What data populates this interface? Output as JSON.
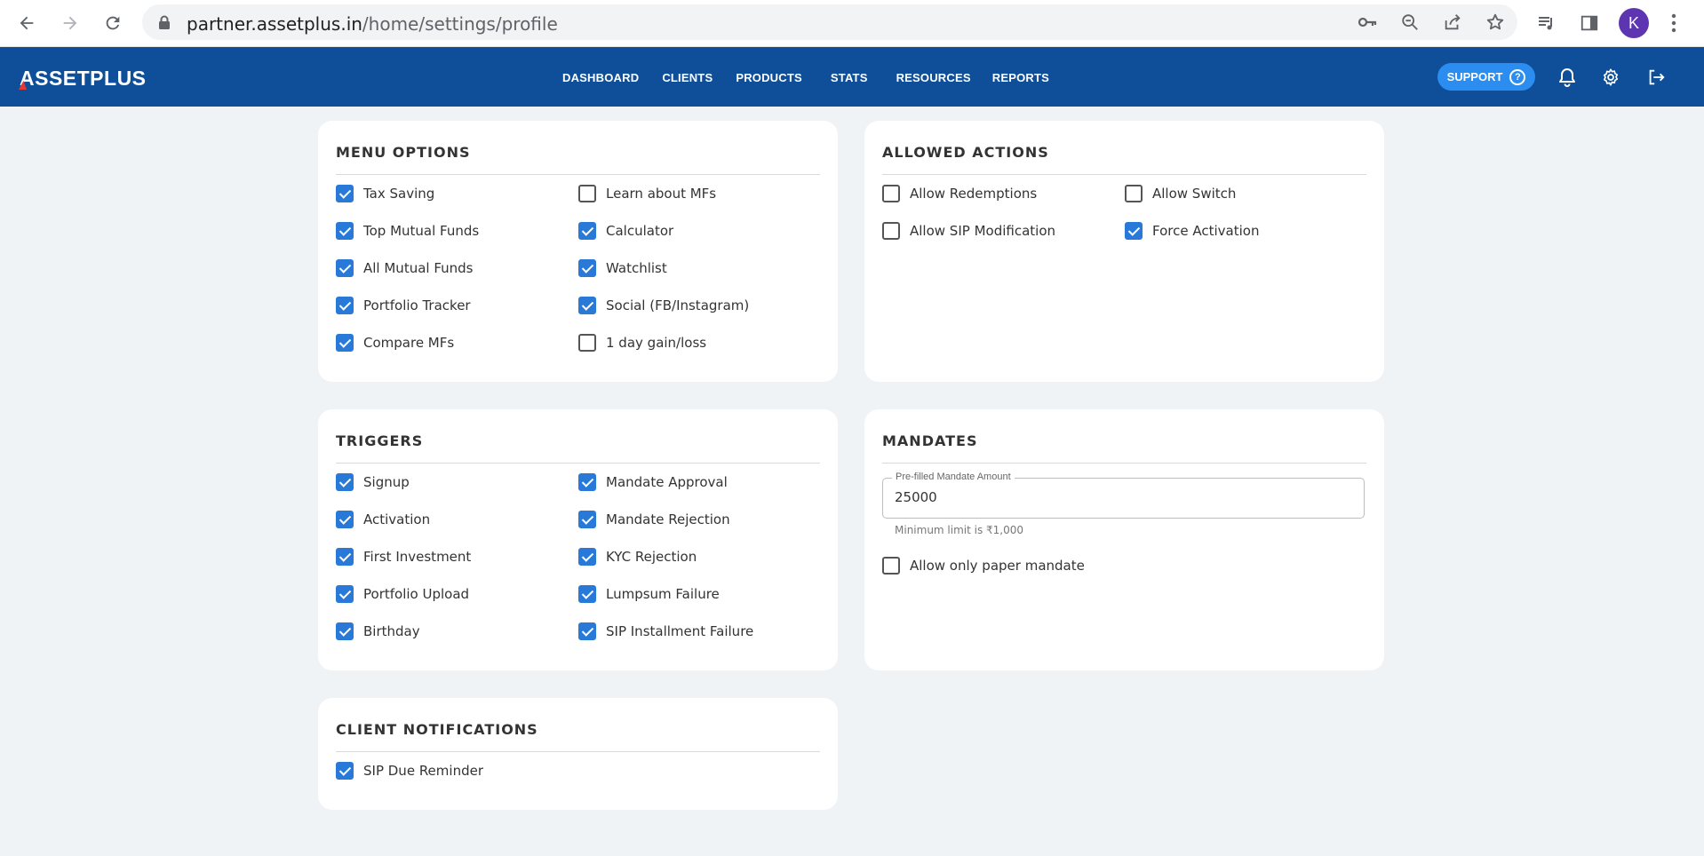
{
  "browser": {
    "url_host": "partner.assetplus.in",
    "url_path": "/home/settings/profile",
    "profile_initial": "K"
  },
  "header": {
    "logo": "ASSETPLUS",
    "nav": [
      "DASHBOARD",
      "CLIENTS",
      "PRODUCTS",
      "STATS",
      "RESOURCES",
      "REPORTS"
    ],
    "support_label": "SUPPORT"
  },
  "menu_options": {
    "title": "MENU OPTIONS",
    "left": [
      {
        "label": "Tax Saving",
        "checked": true
      },
      {
        "label": "Top Mutual Funds",
        "checked": true
      },
      {
        "label": "All Mutual Funds",
        "checked": true
      },
      {
        "label": "Portfolio Tracker",
        "checked": true
      },
      {
        "label": "Compare MFs",
        "checked": true
      }
    ],
    "right": [
      {
        "label": "Learn about MFs",
        "checked": false
      },
      {
        "label": "Calculator",
        "checked": true
      },
      {
        "label": "Watchlist",
        "checked": true
      },
      {
        "label": "Social (FB/Instagram)",
        "checked": true
      },
      {
        "label": "1 day gain/loss",
        "checked": false
      }
    ]
  },
  "allowed_actions": {
    "title": "ALLOWED ACTIONS",
    "left": [
      {
        "label": "Allow Redemptions",
        "checked": false
      },
      {
        "label": "Allow SIP Modification",
        "checked": false
      }
    ],
    "right": [
      {
        "label": "Allow Switch",
        "checked": false
      },
      {
        "label": "Force Activation",
        "checked": true
      }
    ]
  },
  "triggers": {
    "title": "TRIGGERS",
    "left": [
      {
        "label": "Signup",
        "checked": true
      },
      {
        "label": "Activation",
        "checked": true
      },
      {
        "label": "First Investment",
        "checked": true
      },
      {
        "label": "Portfolio Upload",
        "checked": true
      },
      {
        "label": "Birthday",
        "checked": true
      }
    ],
    "right": [
      {
        "label": "Mandate Approval",
        "checked": true
      },
      {
        "label": "Mandate Rejection",
        "checked": true
      },
      {
        "label": "KYC Rejection",
        "checked": true
      },
      {
        "label": "Lumpsum Failure",
        "checked": true
      },
      {
        "label": "SIP Installment Failure",
        "checked": true
      }
    ]
  },
  "mandates": {
    "title": "MANDATES",
    "field_label": "Pre-filled Mandate Amount",
    "field_value": "25000",
    "hint": "Minimum limit is ₹1,000",
    "paper_mandate": {
      "label": "Allow only paper mandate",
      "checked": false
    }
  },
  "client_notifications": {
    "title": "CLIENT NOTIFICATIONS",
    "items": [
      {
        "label": "SIP Due Reminder",
        "checked": true
      }
    ]
  }
}
